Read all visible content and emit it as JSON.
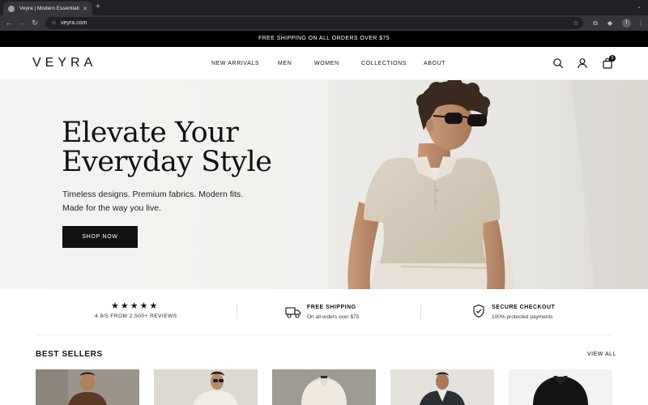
{
  "browser": {
    "tab_title": "Veyra | Modern Essentials",
    "tab_close": "✕",
    "new_tab": "+",
    "url": "veyra.com",
    "profile_initial": "I"
  },
  "announcement": "FREE SHIPPING ON ALL ORDERS OVER $75",
  "header": {
    "logo": "VEYRA",
    "nav": [
      "NEW ARRIVALS",
      "MEN",
      "WOMEN",
      "COLLECTIONS",
      "ABOUT"
    ],
    "icons": [
      "search-icon",
      "account-icon",
      "bag-icon"
    ],
    "cart_count": "0"
  },
  "hero": {
    "title_line1": "Elevate Your",
    "title_line2": "Everyday Style",
    "subtitle_line1": "Timeless designs. Premium fabrics. Modern fits.",
    "subtitle_line2": "Made for the way you live.",
    "cta": "SHOP NOW"
  },
  "features": {
    "rating": {
      "stars": "★★★★★",
      "text": "4.9/5 FROM 2,500+ REVIEWS"
    },
    "shipping": {
      "icon": "truck-icon",
      "title": "FREE SHIPPING",
      "desc": "On all orders over $75"
    },
    "checkout": {
      "icon": "shield-check-icon",
      "title": "SECURE CHECKOUT",
      "desc": "100% protected payments"
    }
  },
  "best_sellers": {
    "title": "BEST SELLERS",
    "view_all": "VIEW ALL",
    "product_count": 5
  },
  "colors": {
    "accent": "#111111",
    "announcement_bg": "#000000",
    "hero_bg": "#f2f1ee"
  }
}
